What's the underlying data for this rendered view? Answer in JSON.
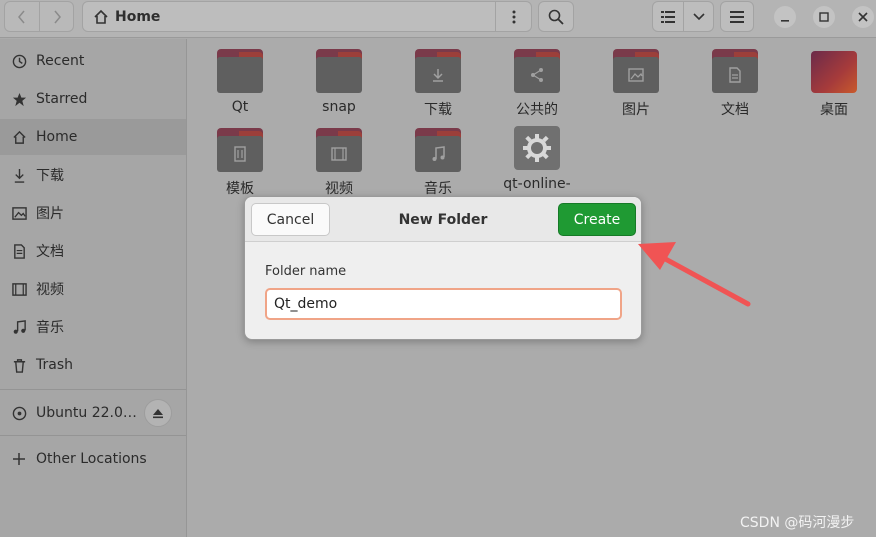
{
  "window": {
    "path_label": "Home",
    "path_icon": "home-icon"
  },
  "sidebar": {
    "items": [
      {
        "label": "Recent",
        "icon": "clock-icon"
      },
      {
        "label": "Starred",
        "icon": "star-icon"
      },
      {
        "label": "Home",
        "icon": "home-icon"
      },
      {
        "label": "下载",
        "icon": "download-icon"
      },
      {
        "label": "图片",
        "icon": "image-icon"
      },
      {
        "label": "文档",
        "icon": "document-icon"
      },
      {
        "label": "视频",
        "icon": "video-icon"
      },
      {
        "label": "音乐",
        "icon": "music-icon"
      },
      {
        "label": "Trash",
        "icon": "trash-icon"
      }
    ],
    "devices": [
      {
        "label": "Ubuntu 22.0…",
        "icon": "disc-icon"
      }
    ],
    "other": {
      "label": "Other Locations",
      "icon": "plus-icon"
    }
  },
  "files": [
    {
      "name": "Qt",
      "icon": "folder-icon"
    },
    {
      "name": "snap",
      "icon": "folder-icon"
    },
    {
      "name": "下载",
      "icon": "folder-download-icon"
    },
    {
      "name": "公共的",
      "icon": "folder-share-icon"
    },
    {
      "name": "图片",
      "icon": "folder-pictures-icon"
    },
    {
      "name": "文档",
      "icon": "folder-documents-icon"
    },
    {
      "name": "桌面",
      "icon": "desktop-folder-icon"
    },
    {
      "name": "模板",
      "icon": "folder-templates-icon"
    },
    {
      "name": "视频",
      "icon": "folder-video-icon"
    },
    {
      "name": "音乐",
      "icon": "folder-music-icon"
    },
    {
      "name": "qt-online-",
      "icon": "gear-icon"
    }
  ],
  "dialog": {
    "title": "New Folder",
    "cancel_label": "Cancel",
    "create_label": "Create",
    "field_label": "Folder name",
    "field_value": "Qt_demo"
  },
  "watermark": "CSDN @码河漫步",
  "colors": {
    "create_button": "#1f9a33",
    "input_focus_border": "#f0a487",
    "annotation_arrow": "#f05454"
  }
}
